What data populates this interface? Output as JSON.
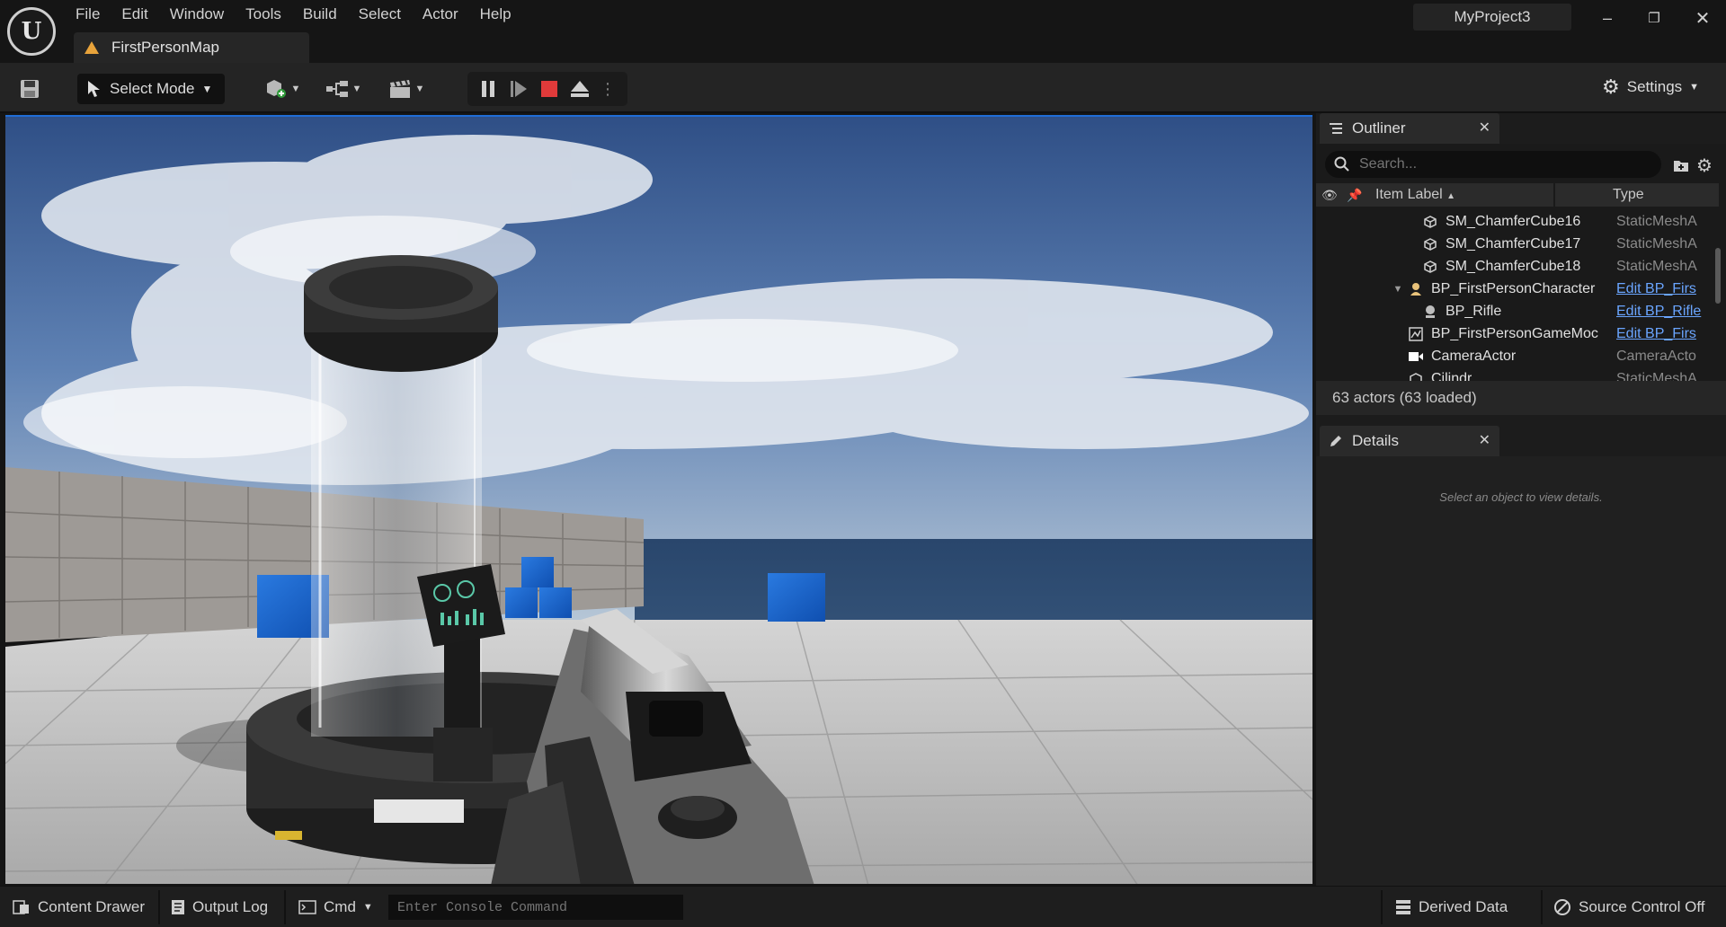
{
  "app": {
    "project_name": "MyProject3",
    "map_tab": "FirstPersonMap"
  },
  "menu": [
    "File",
    "Edit",
    "Window",
    "Tools",
    "Build",
    "Select",
    "Actor",
    "Help"
  ],
  "toolbar": {
    "select_mode_label": "Select Mode",
    "settings_label": "Settings"
  },
  "outliner": {
    "title": "Outliner",
    "search_placeholder": "Search...",
    "col_label": "Item Label",
    "col_type": "Type",
    "rows": [
      {
        "label": "SM_ChamferCube16",
        "type": "StaticMeshA",
        "icon": "static-mesh-icon"
      },
      {
        "label": "SM_ChamferCube17",
        "type": "StaticMeshA",
        "icon": "static-mesh-icon"
      },
      {
        "label": "SM_ChamferCube18",
        "type": "StaticMeshA",
        "icon": "static-mesh-icon"
      },
      {
        "label": "BP_FirstPersonCharacter",
        "type": "Edit BP_Firs",
        "icon": "character-icon"
      },
      {
        "label": "BP_Rifle",
        "type": "Edit BP_Rifle",
        "icon": "actor-icon"
      },
      {
        "label": "BP_FirstPersonGameMoc",
        "type": "Edit BP_Firs",
        "icon": "game-mode-icon"
      },
      {
        "label": "CameraActor",
        "type": "CameraActo",
        "icon": "camera-icon"
      },
      {
        "label": "Cilindr",
        "type": "StaticMeshA",
        "icon": "static-mesh-icon"
      }
    ],
    "actors_count": "63 actors (63 loaded)"
  },
  "details": {
    "title": "Details",
    "hint": "Select an object to view details."
  },
  "bottom": {
    "content_drawer": "Content Drawer",
    "output_log": "Output Log",
    "cmd": "Cmd",
    "console_placeholder": "Enter Console Command",
    "derived_data": "Derived Data",
    "source_control": "Source Control Off"
  },
  "colors": {
    "accent": "#1f6dd6",
    "stop_red": "#e03a3a",
    "link_blue": "#6aa5ff",
    "warning_orange": "#e8a33b"
  }
}
